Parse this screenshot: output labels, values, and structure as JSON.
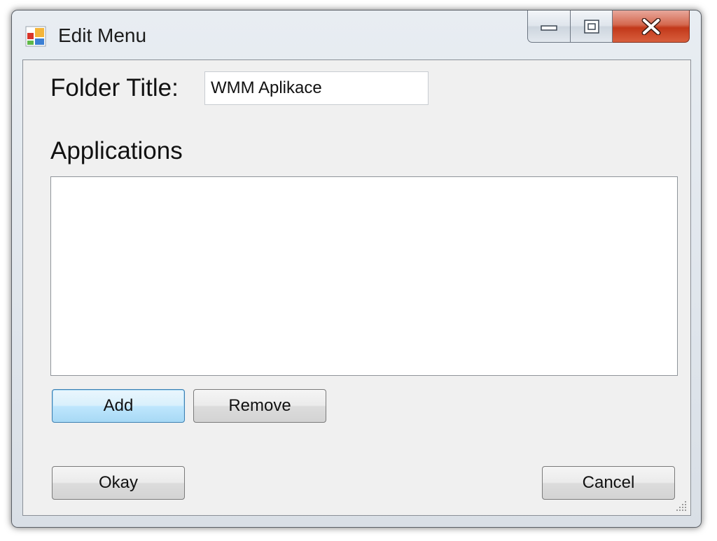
{
  "window": {
    "title": "Edit Menu",
    "icon": "app-window-icon"
  },
  "titlebar_buttons": {
    "minimize_icon": "minimize-icon",
    "maximize_icon": "maximize-icon",
    "close_icon": "close-icon"
  },
  "form": {
    "folder_title_label": "Folder Title:",
    "folder_title_value": "WMM Aplikace",
    "applications_label": "Applications",
    "applications_items": []
  },
  "buttons": {
    "add_label": "Add",
    "remove_label": "Remove",
    "okay_label": "Okay",
    "cancel_label": "Cancel"
  },
  "colors": {
    "close_button": "#c2381a",
    "default_button_border": "#3c7fb1",
    "client_background": "#f0f0f0"
  }
}
